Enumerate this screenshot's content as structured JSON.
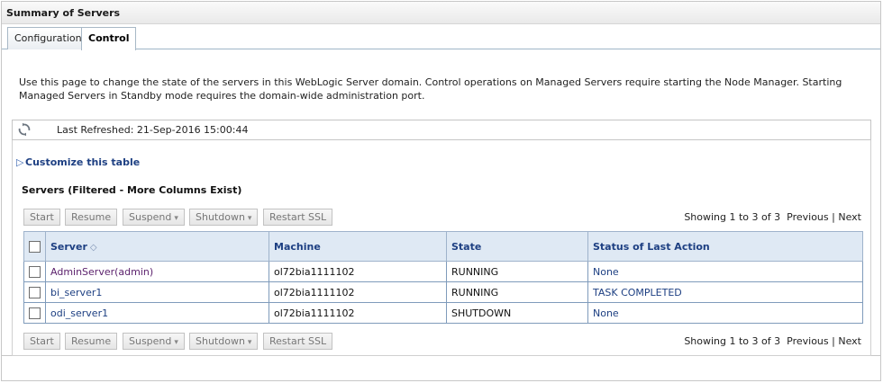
{
  "title": "Summary of Servers",
  "tabs": [
    {
      "label": "Configuration"
    },
    {
      "label": "Control"
    }
  ],
  "description": "Use this page to change the state of the servers in this WebLogic Server domain. Control operations on Managed Servers require starting the Node Manager. Starting Managed Servers in Standby mode requires the domain-wide administration port.",
  "refresh": {
    "label": "Last Refreshed: 21-Sep-2016 15:00:44",
    "icon": "refresh-icon"
  },
  "customize_label": "Customize this table",
  "table_title": "Servers (Filtered - More Columns Exist)",
  "buttons": {
    "start": "Start",
    "resume": "Resume",
    "suspend": "Suspend",
    "shutdown": "Shutdown",
    "restart_ssl": "Restart SSL"
  },
  "paging": {
    "showing": "Showing 1 to 3 of 3",
    "previous": "Previous",
    "separator": "|",
    "next": "Next"
  },
  "columns": [
    "Server",
    "Machine",
    "State",
    "Status of Last Action"
  ],
  "rows": [
    {
      "server": "AdminServer(admin)",
      "machine": "ol72bia1111102",
      "state": "RUNNING",
      "status": "None"
    },
    {
      "server": "bi_server1",
      "machine": "ol72bia1111102",
      "state": "RUNNING",
      "status": "TASK COMPLETED"
    },
    {
      "server": "odi_server1",
      "machine": "ol72bia1111102",
      "state": "SHUTDOWN",
      "status": "None"
    }
  ]
}
